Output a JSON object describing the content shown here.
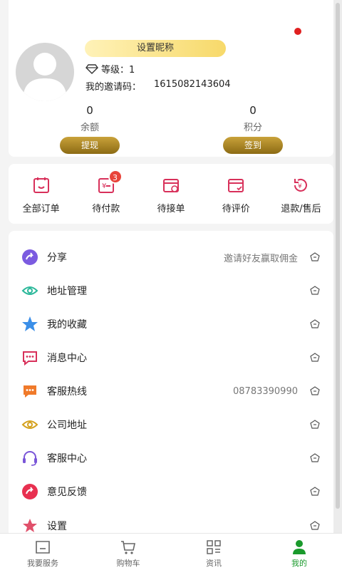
{
  "profile": {
    "nickname_button": "设置昵称",
    "level_label": "等级：1",
    "invite_label": "我的邀请码：",
    "invite_code": "1615082143604"
  },
  "stats": {
    "balance": {
      "value": "0",
      "label": "余额",
      "button": "提现"
    },
    "points": {
      "value": "0",
      "label": "积分",
      "button": "签到"
    }
  },
  "orders": [
    {
      "label": "全部订单",
      "icon": "all-orders-icon"
    },
    {
      "label": "待付款",
      "icon": "pending-payment-icon",
      "badge": "3"
    },
    {
      "label": "待接单",
      "icon": "pending-accept-icon"
    },
    {
      "label": "待评价",
      "icon": "pending-review-icon"
    },
    {
      "label": "退款/售后",
      "icon": "refund-icon"
    }
  ],
  "menu": [
    {
      "label": "分享",
      "extra": "邀请好友赢取佣金",
      "icon": "share-icon",
      "color": "#7b5be0"
    },
    {
      "label": "地址管理",
      "extra": "",
      "icon": "address-icon",
      "color": "#2bb89a"
    },
    {
      "label": "我的收藏",
      "extra": "",
      "icon": "star-icon",
      "color": "#3b8fe8"
    },
    {
      "label": "消息中心",
      "extra": "",
      "icon": "message-icon",
      "color": "#d8305a"
    },
    {
      "label": "客服热线",
      "extra": "08783390990",
      "icon": "hotline-icon",
      "color": "#f07a2a"
    },
    {
      "label": "公司地址",
      "extra": "",
      "icon": "location-icon",
      "color": "#d4a11e"
    },
    {
      "label": "客服中心",
      "extra": "",
      "icon": "headset-icon",
      "color": "#7a56d8"
    },
    {
      "label": "意见反馈",
      "extra": "",
      "icon": "feedback-icon",
      "color": "#e83050"
    },
    {
      "label": "设置",
      "extra": "",
      "icon": "settings-icon",
      "color": "#e0506a"
    }
  ],
  "tabs": [
    {
      "label": "我要服务",
      "icon": "service-icon"
    },
    {
      "label": "购物车",
      "icon": "cart-icon"
    },
    {
      "label": "资讯",
      "icon": "news-icon"
    },
    {
      "label": "我的",
      "icon": "profile-icon",
      "active": true
    }
  ],
  "colors": {
    "gold_start": "#c9a23a",
    "gold_end": "#8c6b14",
    "active_tab": "#1a9a2c",
    "badge": "#e8443a",
    "order_icon": "#d8305a"
  }
}
